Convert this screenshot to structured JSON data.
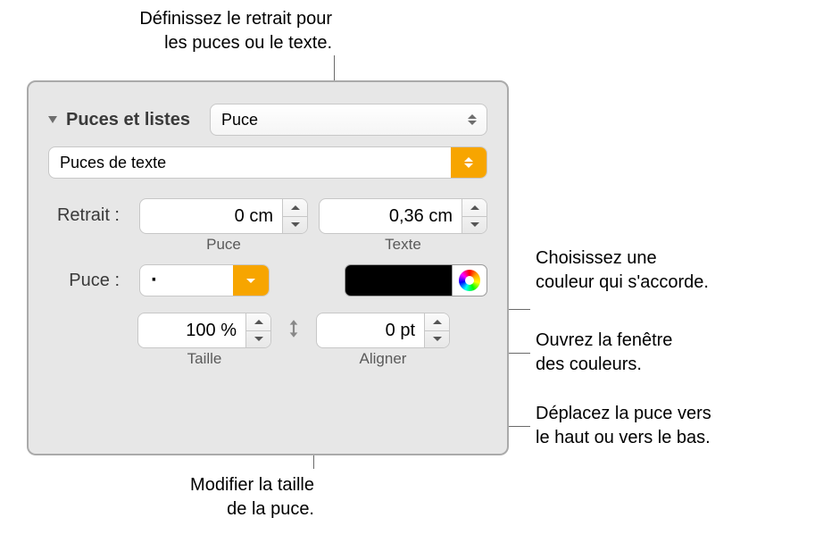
{
  "callouts": {
    "top": "Définissez le retrait pour\nles puces ou le texte.",
    "r1": "Choisissez une\ncouleur qui s'accorde.",
    "r2": "Ouvrez la fenêtre\ndes couleurs.",
    "r3": "Déplacez la puce vers\nle haut ou vers le bas.",
    "bottom": "Modifier la taille\nde la puce."
  },
  "panel": {
    "section_title": "Puces et listes",
    "style_popup": "Puce",
    "bullet_type": "Puces de texte",
    "indent_label": "Retrait :",
    "indent_bullet_value": "0 cm",
    "indent_bullet_sub": "Puce",
    "indent_text_value": "0,36 cm",
    "indent_text_sub": "Texte",
    "bullet_label": "Puce :",
    "bullet_char": "·",
    "size_value": "100 %",
    "size_sub": "Taille",
    "align_value": "0 pt",
    "align_sub": "Aligner"
  }
}
